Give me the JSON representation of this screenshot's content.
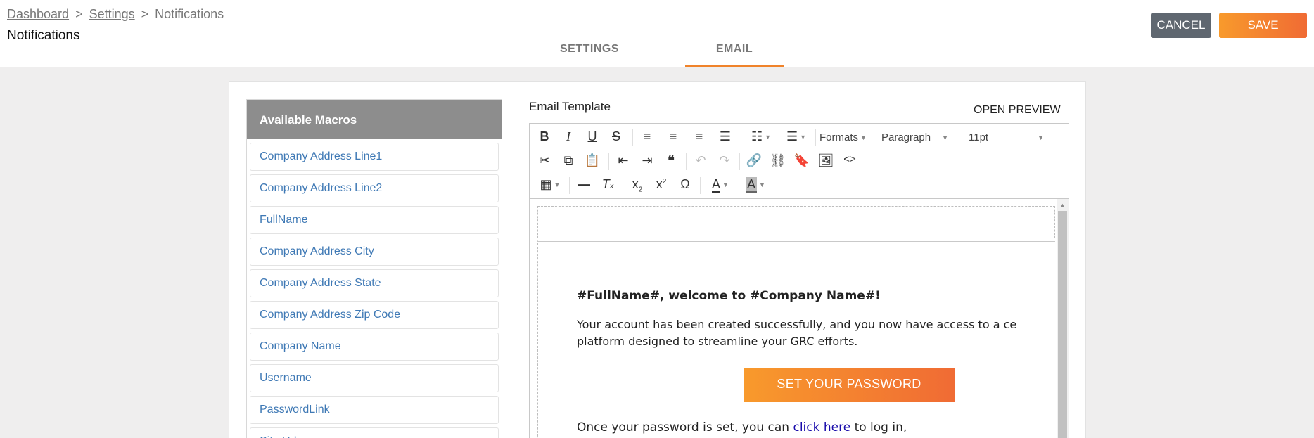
{
  "breadcrumb": {
    "items": [
      "Dashboard",
      "Settings",
      "Notifications"
    ],
    "separator": ">"
  },
  "page_title": "Notifications",
  "tabs": [
    {
      "label": "SETTINGS",
      "active": false
    },
    {
      "label": "EMAIL",
      "active": true
    }
  ],
  "actions": {
    "cancel_label": "CANCEL",
    "save_label": "SAVE"
  },
  "macros": {
    "title": "Available Macros",
    "items": [
      "Company Address Line1",
      "Company Address Line2",
      "FullName",
      "Company Address City",
      "Company Address State",
      "Company Address Zip Code",
      "Company Name",
      "Username",
      "PasswordLink",
      "Site Url"
    ]
  },
  "editor": {
    "label": "Email Template",
    "preview_label": "OPEN PREVIEW",
    "toolbar": {
      "formats_label": "Formats",
      "block_format": "Paragraph",
      "font_size": "11pt",
      "icons": [
        "bold-icon",
        "italic-icon",
        "underline-icon",
        "strikethrough-icon",
        "align-left-icon",
        "align-center-icon",
        "align-right-icon",
        "align-justify-icon",
        "bullet-list-icon",
        "numbered-list-icon",
        "cut-icon",
        "copy-icon",
        "paste-icon",
        "outdent-icon",
        "indent-icon",
        "blockquote-icon",
        "undo-icon",
        "redo-icon",
        "link-icon",
        "unlink-icon",
        "bookmark-icon",
        "image-icon",
        "code-icon",
        "table-icon",
        "horizontal-rule-icon",
        "clear-format-icon",
        "subscript-icon",
        "superscript-icon",
        "special-char-icon",
        "text-color-icon",
        "background-color-icon"
      ]
    },
    "content": {
      "heading": "#FullName#, welcome to #Company Name#!",
      "paragraph_line1": "Your account has been created successfully, and you now have access to a ce",
      "paragraph_line2": "platform designed to streamline your GRC efforts.",
      "button_label": "SET YOUR PASSWORD",
      "line2_prefix": "Once your password is set, you can ",
      "line2_link": "click here",
      "line2_suffix": " to log in,"
    }
  },
  "colors": {
    "accent": "#f0832a",
    "link": "#3f79b5",
    "cancel": "#5f6770"
  }
}
